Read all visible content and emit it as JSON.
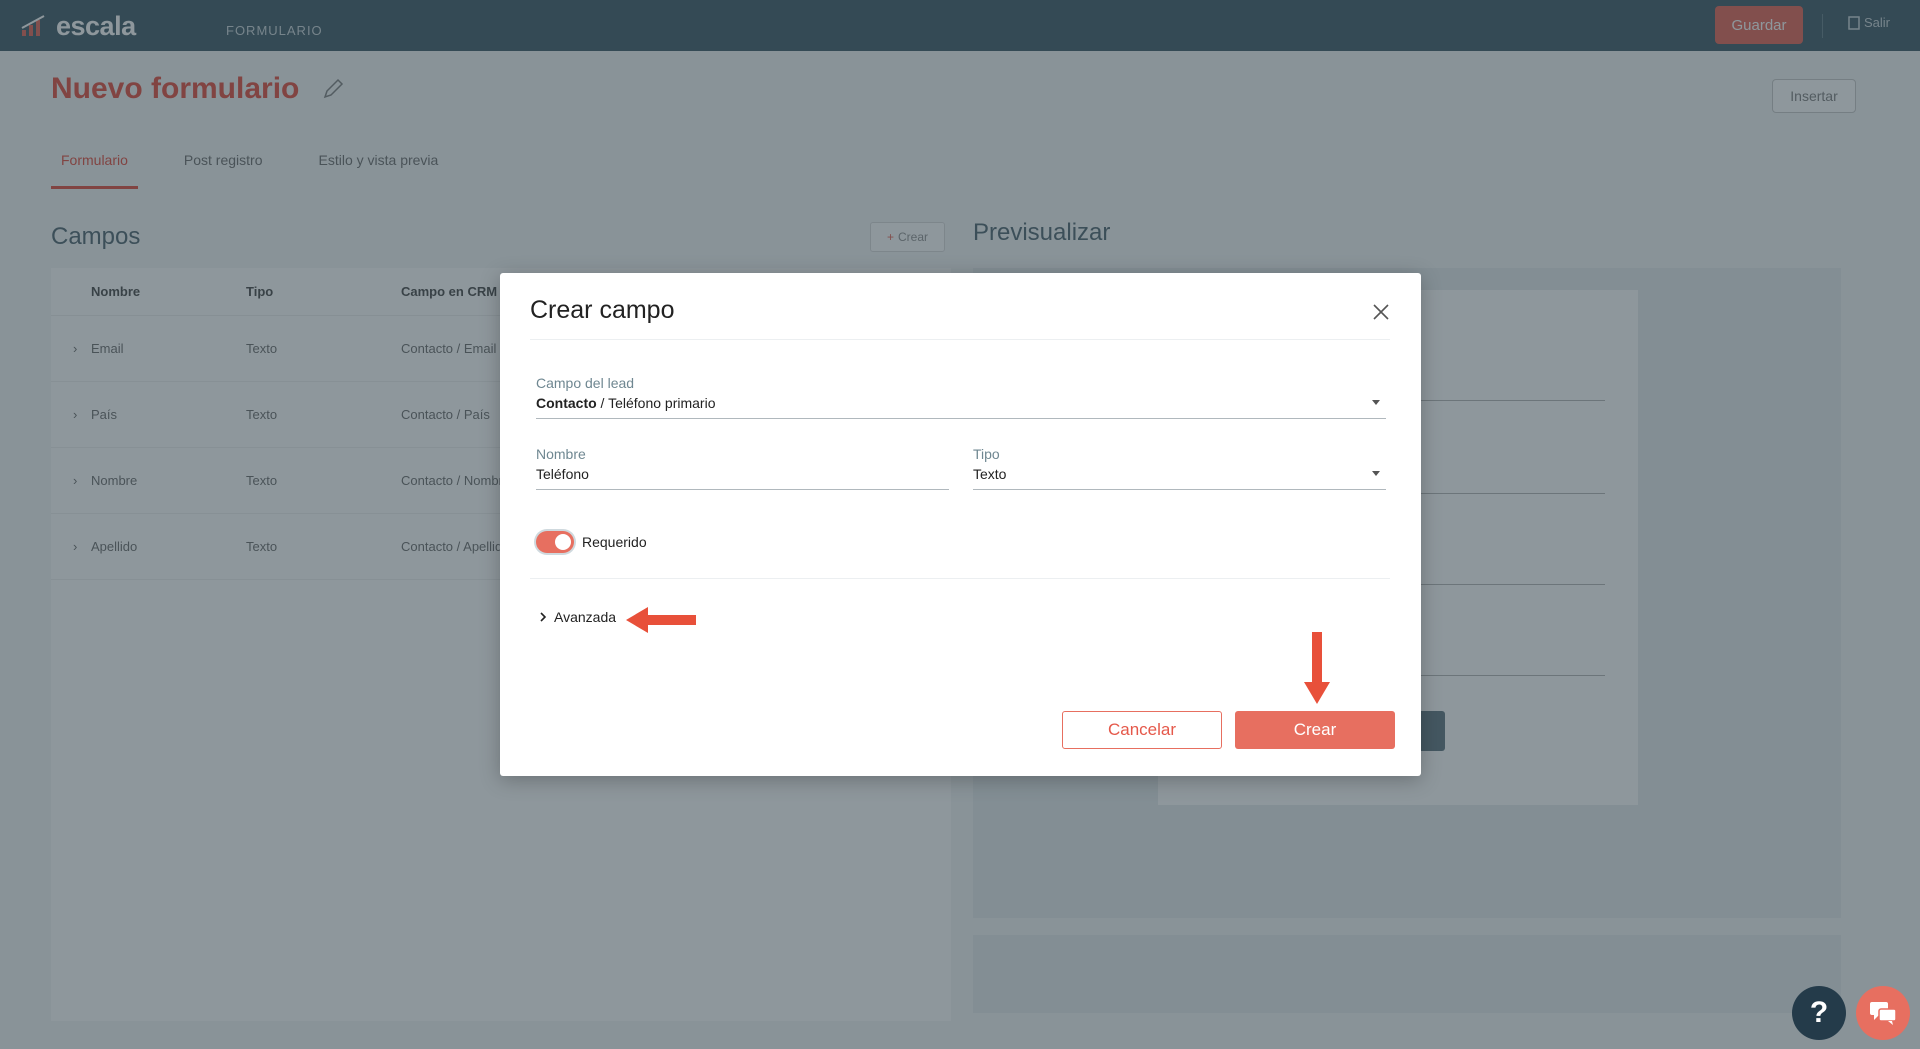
{
  "topbar": {
    "logo_text": "escala",
    "section": "FORMULARIO",
    "save_label": "Guardar",
    "exit_label": "Salir"
  },
  "page": {
    "title": "Nuevo formulario",
    "insert_label": "Insertar",
    "tabs": [
      "Formulario",
      "Post registro",
      "Estilo y vista previa"
    ],
    "fields_title": "Campos",
    "create_small_label": "Crear",
    "table_headers": [
      "Nombre",
      "Tipo",
      "Campo en CRM"
    ],
    "rows": [
      {
        "name": "Email",
        "type": "Texto",
        "crm": "Contacto / Email"
      },
      {
        "name": "País",
        "type": "Texto",
        "crm": "Contacto / País"
      },
      {
        "name": "Nombre",
        "type": "Texto",
        "crm": "Contacto / Nombre"
      },
      {
        "name": "Apellido",
        "type": "Texto",
        "crm": "Contacto / Apellido"
      }
    ],
    "preview_title": "Previsualizar"
  },
  "modal": {
    "title": "Crear campo",
    "lead_field": {
      "label": "Campo del lead",
      "value_bold": "Contacto",
      "value_rest": " / Teléfono primario"
    },
    "name_field": {
      "label": "Nombre",
      "value": "Teléfono"
    },
    "type_field": {
      "label": "Tipo",
      "value": "Texto"
    },
    "required_label": "Requerido",
    "required_on": true,
    "advanced_label": "Avanzada",
    "cancel_label": "Cancelar",
    "create_label": "Crear"
  },
  "colors": {
    "accent": "#e76f60",
    "topbar": "#4b6470",
    "annotation_arrow": "#e8503a"
  }
}
